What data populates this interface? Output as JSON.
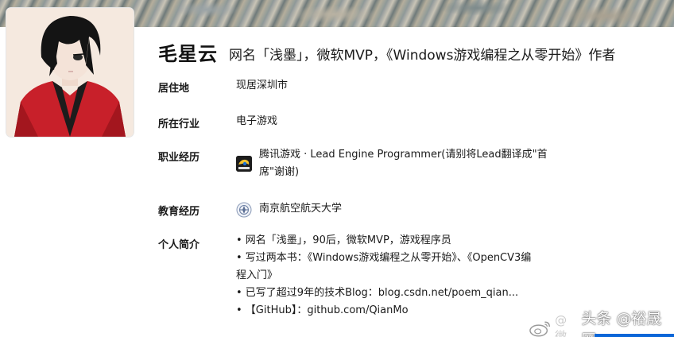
{
  "profile": {
    "name": "毛星云",
    "headline": "网名「浅墨」，微软MVP，《Windows游戏编程之从零开始》作者"
  },
  "fields": {
    "residence": {
      "label": "居住地",
      "value": "现居深圳市"
    },
    "industry": {
      "label": "所在行业",
      "value": "电子游戏"
    },
    "career": {
      "label": "职业经历",
      "value_line1": "腾讯游戏 · Lead Engine Programmer(请别将Lead翻译成\"首",
      "value_line2": "席\"谢谢)",
      "logo_icon": "company-logo-icon"
    },
    "education": {
      "label": "教育经历",
      "value": "南京航空航天大学",
      "logo_icon": "school-emblem-icon"
    },
    "bio": {
      "label": "个人简介",
      "lines": [
        "• 网名「浅墨」，90后，微软MVP，游戏程序员",
        "• 写过两本书：《Windows游戏编程之从零开始》、《OpenCV3编",
        "程入门》",
        "• 已写了超过9年的技术Blog：blog.csdn.net/poem_qian...",
        "• 【GitHub】：github.com/QianMo"
      ]
    }
  },
  "watermark": {
    "ghost_text": "@微",
    "text": "头条 @裕晟网",
    "icon": "weibo-icon"
  },
  "colors": {
    "accent_blue": "#0a66d8",
    "text": "#1a1a1a",
    "avatar_jacket": "#c8202a"
  }
}
